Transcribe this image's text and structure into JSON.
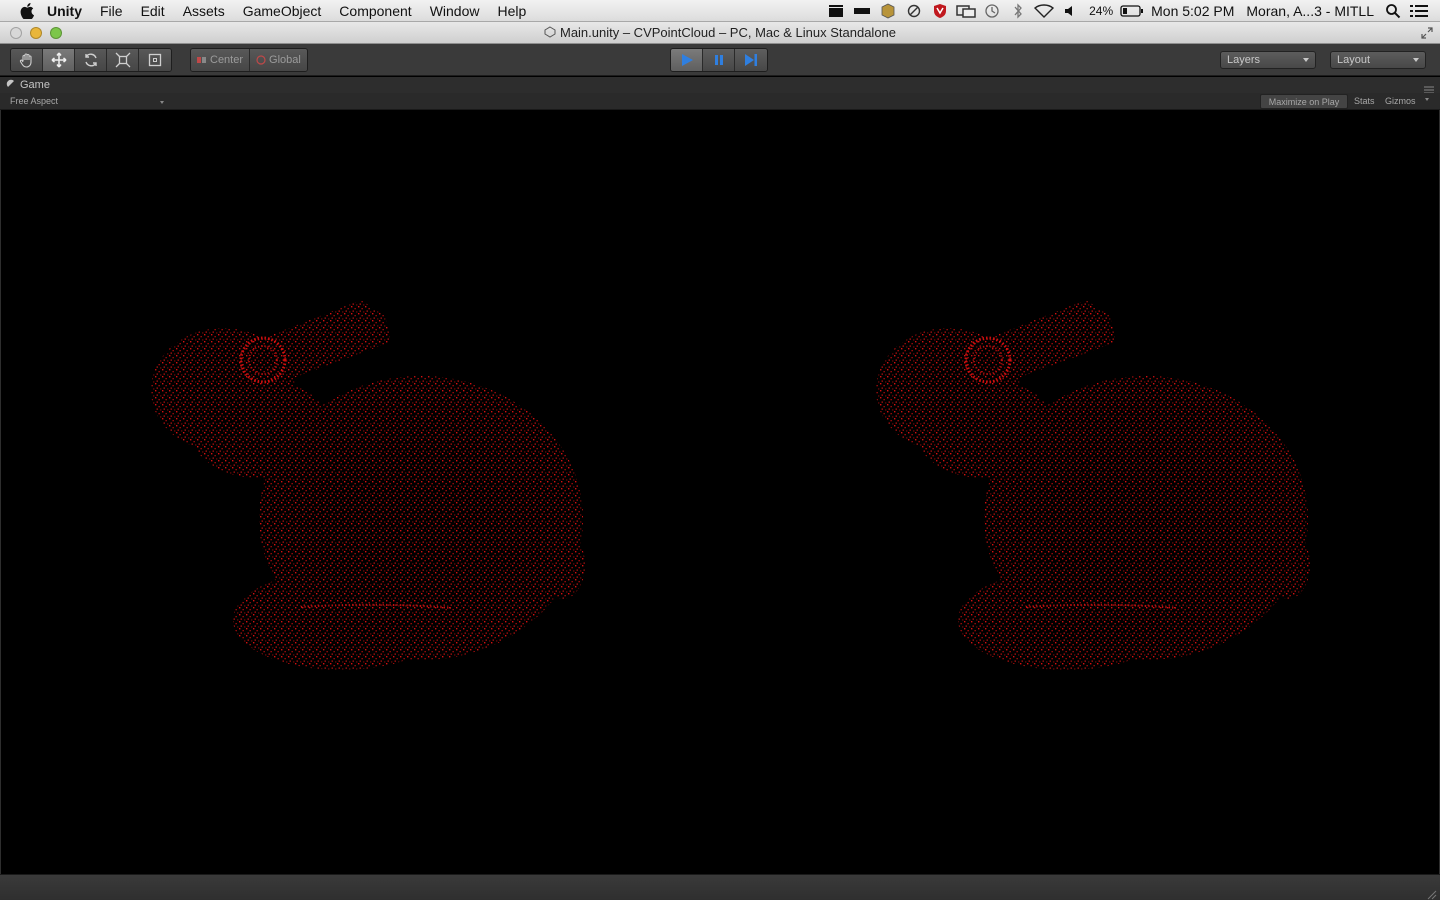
{
  "menubar": {
    "app_name": "Unity",
    "items": [
      "File",
      "Edit",
      "Assets",
      "GameObject",
      "Component",
      "Window",
      "Help"
    ],
    "battery": "24%",
    "clock": "Mon 5:02 PM",
    "user": "Moran, A...3 - MITLL"
  },
  "window": {
    "title": "Main.unity – CVPointCloud – PC, Mac & Linux Standalone"
  },
  "toolbar": {
    "pivot_center": "Center",
    "pivot_global": "Global",
    "layers_label": "Layers",
    "layout_label": "Layout"
  },
  "game_panel": {
    "tab_label": "Game",
    "aspect": "Free Aspect",
    "maximize_on_play": "Maximize on Play",
    "stats": "Stats",
    "gizmos": "Gizmos",
    "point_color": "#e01010"
  },
  "colors": {
    "editor_bg": "#3a3a3a",
    "play_blue": "#2f7fe0",
    "viewport_bg": "#000000"
  }
}
